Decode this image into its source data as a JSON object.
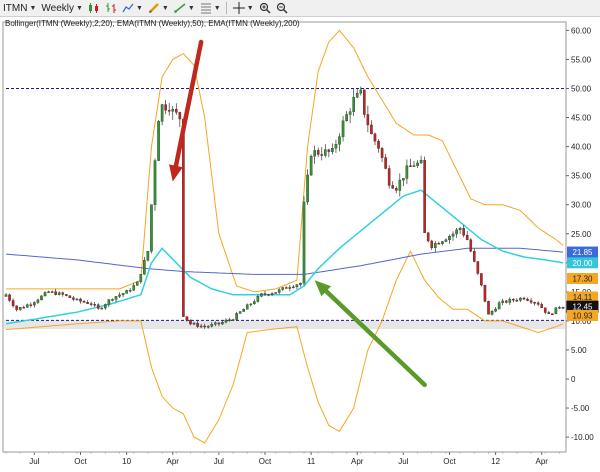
{
  "toolbar": {
    "symbol": "ITMN",
    "timeframe": "Weekly",
    "icons": [
      "symbol-dropdown",
      "timeframe-dropdown",
      "candlestick-style-icon",
      "bar-style-icon",
      "line-style-icon",
      "pencil-draw-icon",
      "trendline-icon",
      "fibonacci-icon",
      "crosshair-icon",
      "zoom-in-icon",
      "zoom-out-icon"
    ]
  },
  "indicator_label": "Bollinger(ITMN (Weekly),2,20), EMA(ITMN (Weekly),50), EMA(ITMN (Weekly),200)",
  "colors": {
    "up_candle": "#2e9a2e",
    "down_candle": "#cc1f1f",
    "bollinger": "#f5a623",
    "ema50": "#33d0e0",
    "ema200": "#5566cc",
    "hline": "#1a1a8c",
    "arrow_red": "#c0281e",
    "arrow_green": "#5a9a2a"
  },
  "chart_data": {
    "type": "candlestick",
    "title": "",
    "xlabel": "",
    "ylabel": "",
    "ylim": [
      -12,
      62
    ],
    "y_ticks": [
      "60.00",
      "55.00",
      "50.00",
      "45.00",
      "40.00",
      "35.00",
      "30.00",
      "25.00",
      "20.00",
      "15.00",
      "10.00",
      "5.00",
      "0",
      "-5.00",
      "-10.00"
    ],
    "y_tick_values": [
      60,
      55,
      50,
      45,
      40,
      35,
      30,
      25,
      20,
      15,
      10,
      5,
      0,
      -5,
      -10
    ],
    "x_ticks": [
      "Jul",
      "Oct",
      "10",
      "Apr",
      "Jul",
      "Oct",
      "11",
      "Apr",
      "Jul",
      "Oct",
      "12",
      "Apr"
    ],
    "x_tick_week": [
      8,
      21,
      34,
      47,
      60,
      73,
      86,
      99,
      112,
      125,
      138,
      151
    ],
    "weeks": 158,
    "price_anchors": [
      [
        0,
        14.5
      ],
      [
        3,
        12
      ],
      [
        7,
        13
      ],
      [
        12,
        15
      ],
      [
        16,
        14.5
      ],
      [
        20,
        13.5
      ],
      [
        24,
        13
      ],
      [
        26,
        12
      ],
      [
        30,
        14
      ],
      [
        34,
        15
      ],
      [
        37,
        16.5
      ],
      [
        40,
        22
      ],
      [
        42,
        38
      ],
      [
        43,
        45
      ],
      [
        44,
        47
      ],
      [
        46,
        47
      ],
      [
        47,
        46
      ],
      [
        49,
        45
      ],
      [
        50,
        11
      ],
      [
        52,
        9.5
      ],
      [
        56,
        9
      ],
      [
        60,
        9.5
      ],
      [
        64,
        10.5
      ],
      [
        68,
        12.5
      ],
      [
        72,
        14.5
      ],
      [
        76,
        15
      ],
      [
        80,
        16
      ],
      [
        83,
        16.5
      ],
      [
        84,
        30
      ],
      [
        86,
        39
      ],
      [
        89,
        39
      ],
      [
        92,
        39
      ],
      [
        95,
        44
      ],
      [
        98,
        48
      ],
      [
        100,
        49
      ],
      [
        101,
        46
      ],
      [
        103,
        42
      ],
      [
        105,
        40
      ],
      [
        108,
        34
      ],
      [
        110,
        33
      ],
      [
        113,
        36
      ],
      [
        115,
        37
      ],
      [
        117,
        37
      ],
      [
        118,
        25
      ],
      [
        120,
        23
      ],
      [
        123,
        24
      ],
      [
        126,
        25
      ],
      [
        128,
        26
      ],
      [
        130,
        24
      ],
      [
        132,
        20
      ],
      [
        134,
        16
      ],
      [
        136,
        11
      ],
      [
        139,
        13
      ],
      [
        142,
        13.5
      ],
      [
        146,
        14
      ],
      [
        150,
        13
      ],
      [
        153,
        11
      ],
      [
        156,
        12.5
      ],
      [
        157,
        12.45
      ]
    ],
    "ema50_anchors": [
      [
        0,
        9.5
      ],
      [
        10,
        10.5
      ],
      [
        20,
        11.5
      ],
      [
        30,
        13
      ],
      [
        38,
        14.5
      ],
      [
        41,
        20
      ],
      [
        44,
        22.5
      ],
      [
        48,
        20
      ],
      [
        52,
        17.5
      ],
      [
        58,
        15.5
      ],
      [
        64,
        14.5
      ],
      [
        72,
        14.5
      ],
      [
        80,
        14.5
      ],
      [
        84,
        16
      ],
      [
        88,
        19
      ],
      [
        94,
        22.5
      ],
      [
        100,
        25.5
      ],
      [
        106,
        28.5
      ],
      [
        112,
        31.5
      ],
      [
        117,
        32.5
      ],
      [
        122,
        30
      ],
      [
        128,
        27
      ],
      [
        134,
        24
      ],
      [
        140,
        22
      ],
      [
        146,
        21
      ],
      [
        152,
        20.5
      ],
      [
        157,
        20
      ]
    ],
    "ema200_anchors": [
      [
        0,
        21.5
      ],
      [
        20,
        20.5
      ],
      [
        40,
        19
      ],
      [
        50,
        18.5
      ],
      [
        70,
        18
      ],
      [
        84,
        18
      ],
      [
        100,
        19.5
      ],
      [
        117,
        21.5
      ],
      [
        130,
        22.5
      ],
      [
        145,
        22.5
      ],
      [
        157,
        21.85
      ]
    ],
    "bb_upper_anchors": [
      [
        0,
        15.5
      ],
      [
        10,
        15.5
      ],
      [
        20,
        15.5
      ],
      [
        32,
        15.5
      ],
      [
        38,
        17
      ],
      [
        41,
        40
      ],
      [
        44,
        52
      ],
      [
        47,
        55
      ],
      [
        50,
        56
      ],
      [
        53,
        54
      ],
      [
        56,
        45
      ],
      [
        60,
        25
      ],
      [
        65,
        16
      ],
      [
        70,
        15
      ],
      [
        76,
        15.5
      ],
      [
        82,
        17
      ],
      [
        85,
        40
      ],
      [
        88,
        53
      ],
      [
        91,
        58
      ],
      [
        94,
        60
      ],
      [
        98,
        57
      ],
      [
        102,
        52
      ],
      [
        106,
        48
      ],
      [
        110,
        44
      ],
      [
        115,
        42
      ],
      [
        119,
        42
      ],
      [
        123,
        41
      ],
      [
        127,
        36
      ],
      [
        131,
        31
      ],
      [
        135,
        30
      ],
      [
        140,
        30
      ],
      [
        145,
        29
      ],
      [
        150,
        26
      ],
      [
        155,
        24
      ],
      [
        157,
        23
      ]
    ],
    "bb_lower_anchors": [
      [
        0,
        8.5
      ],
      [
        10,
        9
      ],
      [
        20,
        9.5
      ],
      [
        32,
        10
      ],
      [
        38,
        10
      ],
      [
        41,
        2
      ],
      [
        44,
        -3
      ],
      [
        47,
        -5
      ],
      [
        50,
        -6
      ],
      [
        53,
        -10
      ],
      [
        56,
        -11
      ],
      [
        60,
        -7
      ],
      [
        64,
        -1
      ],
      [
        68,
        8
      ],
      [
        74,
        8.5
      ],
      [
        82,
        9
      ],
      [
        85,
        2
      ],
      [
        88,
        -4
      ],
      [
        91,
        -8
      ],
      [
        94,
        -9
      ],
      [
        98,
        -5
      ],
      [
        102,
        5
      ],
      [
        106,
        10
      ],
      [
        110,
        17
      ],
      [
        114,
        22
      ],
      [
        118,
        17
      ],
      [
        122,
        14
      ],
      [
        126,
        12
      ],
      [
        130,
        12
      ],
      [
        135,
        10
      ],
      [
        140,
        10
      ],
      [
        145,
        9
      ],
      [
        150,
        8
      ],
      [
        155,
        9
      ],
      [
        157,
        9.5
      ]
    ],
    "horizontal_lines": [
      50.0,
      10.1
    ],
    "price_labels": [
      {
        "text": "21.85",
        "value": 21.85,
        "color": "#3a6bd8"
      },
      {
        "text": "20.00",
        "value": 20.0,
        "color": "#33c6d8"
      },
      {
        "text": "17.30",
        "value": 17.3,
        "color": "#f5a623"
      },
      {
        "text": "14.11",
        "value": 14.11,
        "color": "#f5a623"
      },
      {
        "text": "12.45",
        "value": 12.45,
        "color": "#111111"
      },
      {
        "text": "10.93",
        "value": 10.93,
        "color": "#f5a623"
      }
    ],
    "annotations": [
      {
        "type": "arrow",
        "color": "red",
        "from": [
          55,
          58
        ],
        "to": [
          47,
          34
        ]
      },
      {
        "type": "arrow",
        "color": "green",
        "from": [
          118,
          -1
        ],
        "to": [
          87,
          17
        ]
      }
    ]
  }
}
